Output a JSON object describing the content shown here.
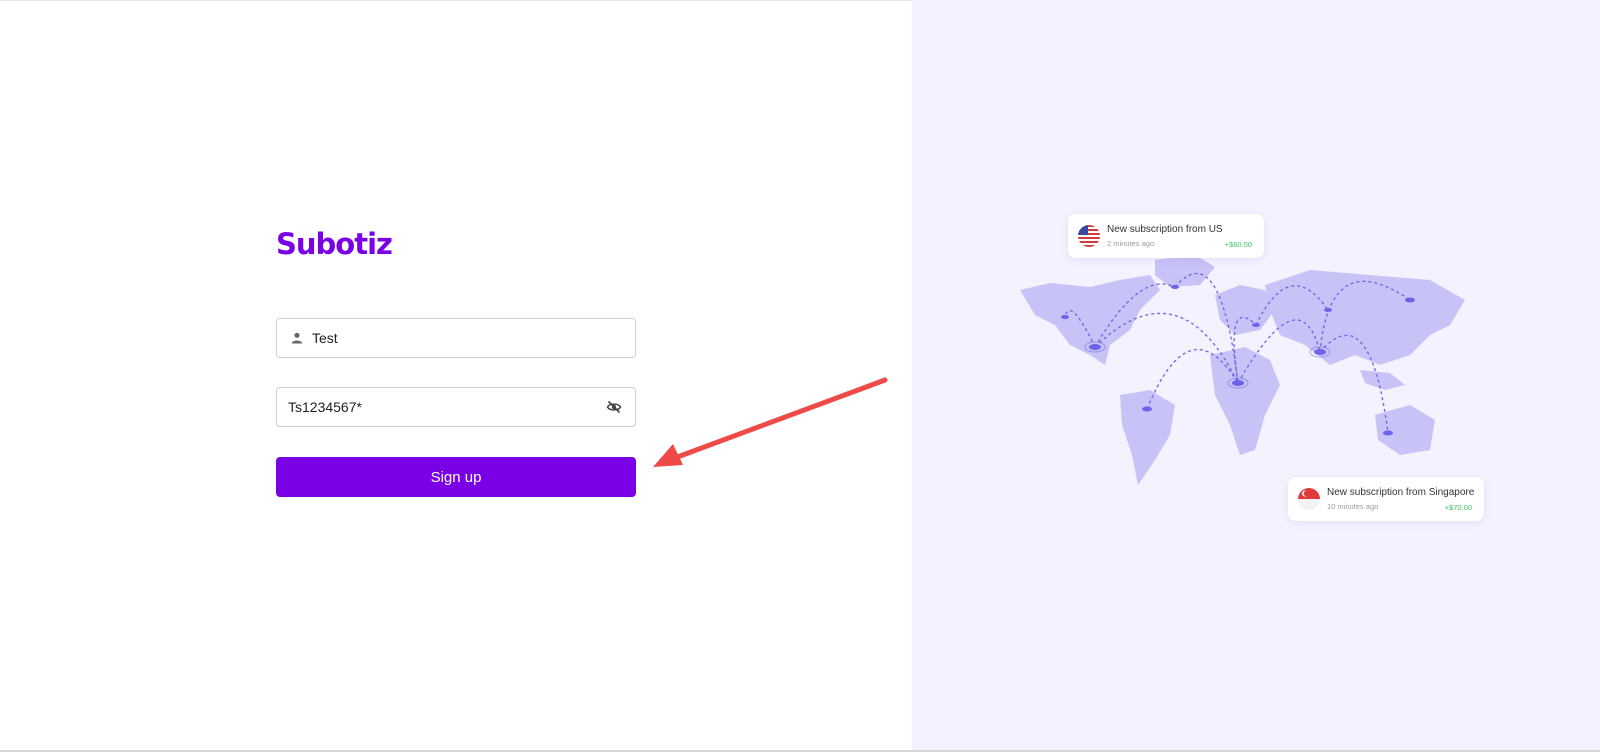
{
  "brand": {
    "logo_text": "Subotiz",
    "accent_color": "#7a00e6"
  },
  "form": {
    "username": {
      "value": "Test",
      "icon": "user-icon"
    },
    "password": {
      "value": "Ts1234567*",
      "toggle_icon": "eye-off-icon"
    },
    "submit_label": "Sign up"
  },
  "notifications": [
    {
      "title": "New subscription from US",
      "time": "2 minutes ago",
      "amount": "+$60.00",
      "flag": "us-flag-icon"
    },
    {
      "title": "New subscription from Singapore",
      "time": "10 minutes ago",
      "amount": "+$70.00",
      "flag": "singapore-flag-icon"
    }
  ],
  "colors": {
    "panel_bg": "#f4f2fe",
    "map_fill": "#c8c3f7",
    "route": "#6c63e8",
    "amount_green": "#3cc36b",
    "annotation_arrow": "#ee4b48"
  }
}
